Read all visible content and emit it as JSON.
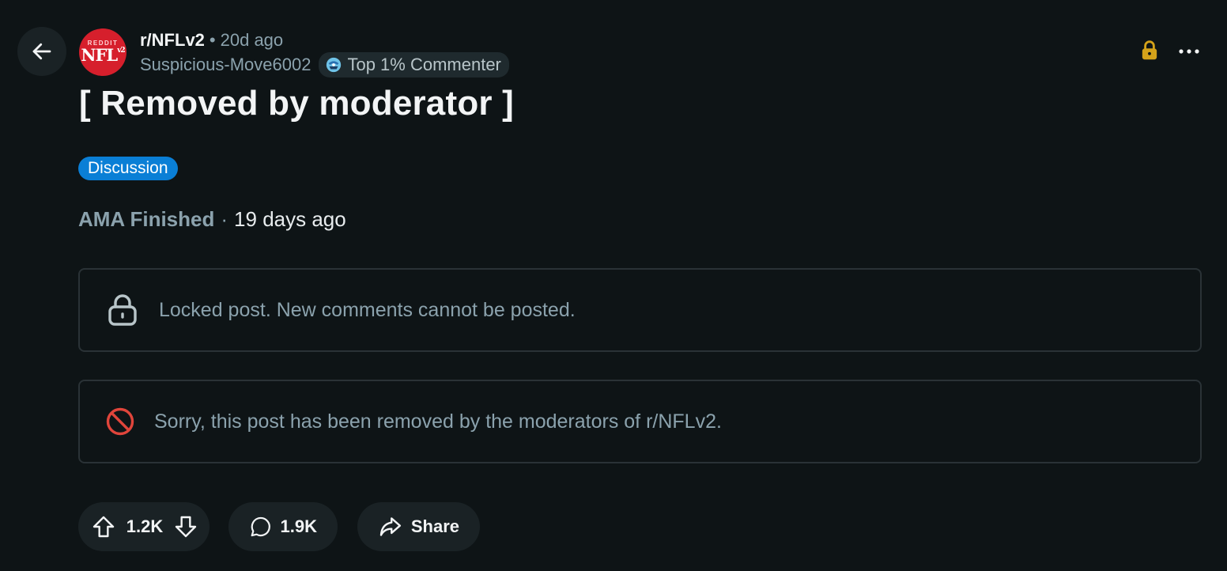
{
  "post": {
    "subreddit": "r/NFLv2",
    "separator": "•",
    "age": "20d ago",
    "author": "Suspicious-Move6002",
    "author_badge": "Top 1% Commenter",
    "title": "[ Removed by moderator ]",
    "flair": "Discussion",
    "ama_status": "AMA Finished",
    "ama_separator": "·",
    "ama_time": "19 days ago"
  },
  "avatar": {
    "top_text": "REDDIT",
    "main_text": "NFL",
    "sup_text": "v2",
    "color": "#d61f2c"
  },
  "notices": {
    "locked": "Locked post. New comments cannot be posted.",
    "removed": "Sorry, this post has been removed by the moderators of r/NFLv2."
  },
  "actions": {
    "votes": "1.2K",
    "comments": "1.9K",
    "share": "Share"
  },
  "colors": {
    "background": "#0e1416",
    "flair": "#0a7fd6",
    "lock_accent": "#d4a21a",
    "removed_accent": "#e0453b",
    "muted_text": "#8ba2ad"
  },
  "icons": {
    "back": "arrow-left-icon",
    "lock_top": "lock-icon",
    "more": "more-horizontal-icon",
    "badge": "commenter-badge-icon",
    "locked_notice": "lock-outline-icon",
    "removed_notice": "prohibited-icon",
    "upvote": "upvote-arrow-icon",
    "downvote": "downvote-arrow-icon",
    "comment": "comment-bubble-icon",
    "share": "share-arrow-icon"
  }
}
